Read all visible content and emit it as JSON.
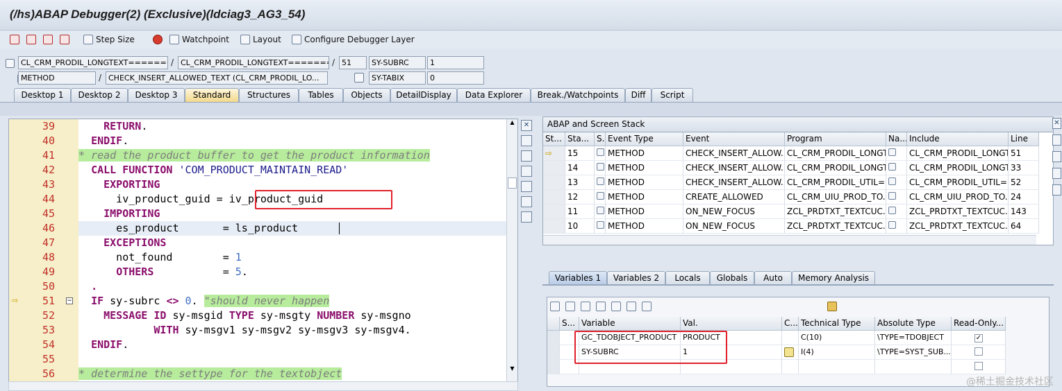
{
  "window": {
    "title": "(/hs)ABAP Debugger(2)  (Exclusive)(ldciag3_AG3_54)"
  },
  "toolbar": {
    "step_size": "Step Size",
    "watchpoint": "Watchpoint",
    "layout": "Layout",
    "configure": "Configure Debugger Layer"
  },
  "fields": {
    "row1": {
      "f1": "CL_CRM_PRODIL_LONGTEXT=======",
      "sep1": "/",
      "f2": "CL_CRM_PRODIL_LONGTEXT=======",
      "sep2": "/",
      "line": "51",
      "sysname": "SY-SUBRC",
      "sysval": "1"
    },
    "row2": {
      "type": "METHOD",
      "sep": "/",
      "name": "CHECK_INSERT_ALLOWED_TEXT (CL_CRM_PRODIL_LO...",
      "sysname": "SY-TABIX",
      "sysval": "0"
    }
  },
  "tabs": [
    "Desktop 1",
    "Desktop 2",
    "Desktop 3",
    "Standard",
    "Structures",
    "Tables",
    "Objects",
    "DetailDisplay",
    "Data Explorer",
    "Break./Watchpoints",
    "Diff",
    "Script"
  ],
  "active_tab": "Standard",
  "code": {
    "lines": [
      {
        "n": "39",
        "t": "    RETURN."
      },
      {
        "n": "40",
        "t": "  ENDIF."
      },
      {
        "n": "41",
        "t": "* read the product buffer to get the product information"
      },
      {
        "n": "42",
        "t": "  CALL FUNCTION 'COM_PRODUCT_MAINTAIN_READ'"
      },
      {
        "n": "43",
        "t": "    EXPORTING"
      },
      {
        "n": "44",
        "t": "      iv_product_guid = iv_product_guid"
      },
      {
        "n": "45",
        "t": "    IMPORTING"
      },
      {
        "n": "46",
        "t": "      es_product       = ls_product"
      },
      {
        "n": "47",
        "t": "    EXCEPTIONS"
      },
      {
        "n": "48",
        "t": "      not_found        = 1"
      },
      {
        "n": "49",
        "t": "      OTHERS           = 5."
      },
      {
        "n": "50",
        "t": "  ."
      },
      {
        "n": "51",
        "t": "  IF sy-subrc <> 0. \"should never happen"
      },
      {
        "n": "52",
        "t": "    MESSAGE ID sy-msgid TYPE sy-msgty NUMBER sy-msgno"
      },
      {
        "n": "53",
        "t": "            WITH sy-msgv1 sy-msgv2 sy-msgv3 sy-msgv4."
      },
      {
        "n": "54",
        "t": "  ENDIF."
      },
      {
        "n": "55",
        "t": ""
      },
      {
        "n": "56",
        "t": "* determine the settype for the textobject"
      }
    ]
  },
  "stack": {
    "title": "ABAP and Screen Stack",
    "headers": [
      "St...",
      "Sta...",
      "S...",
      "Event Type",
      "Event",
      "Program",
      "Na...",
      "Include",
      "Line"
    ],
    "rows": [
      {
        "sta": "15",
        "etype": "METHOD",
        "event": "CHECK_INSERT_ALLOW...",
        "program": "CL_CRM_PRODIL_LONGT...",
        "include": "CL_CRM_PRODIL_LONGT...",
        "line": "51"
      },
      {
        "sta": "14",
        "etype": "METHOD",
        "event": "CHECK_INSERT_ALLOW...",
        "program": "CL_CRM_PRODIL_LONGT...",
        "include": "CL_CRM_PRODIL_LONGT...",
        "line": "33"
      },
      {
        "sta": "13",
        "etype": "METHOD",
        "event": "CHECK_INSERT_ALLOW...",
        "program": "CL_CRM_PRODIL_UTIL=...",
        "include": "CL_CRM_PRODIL_UTIL=...",
        "line": "52"
      },
      {
        "sta": "12",
        "etype": "METHOD",
        "event": "CREATE_ALLOWED",
        "program": "CL_CRM_UIU_PROD_TO...",
        "include": "CL_CRM_UIU_PROD_TO...",
        "line": "24"
      },
      {
        "sta": "11",
        "etype": "METHOD",
        "event": "ON_NEW_FOCUS",
        "program": "ZCL_PRDTXT_TEXTCUC...",
        "include": "ZCL_PRDTXT_TEXTCUC...",
        "line": "143"
      },
      {
        "sta": "10",
        "etype": "METHOD",
        "event": "ON_NEW_FOCUS",
        "program": "ZCL_PRDTXT_TEXTCUC...",
        "include": "ZCL_PRDTXT_TEXTCUC...",
        "line": "64"
      }
    ]
  },
  "var_tabs": [
    "Variables 1",
    "Variables 2",
    "Locals",
    "Globals",
    "Auto",
    "Memory Analysis"
  ],
  "active_var_tab": "Variables 1",
  "vars": {
    "headers": [
      "S...",
      "Variable",
      "Val.",
      "C...",
      "Technical Type",
      "Absolute Type",
      "Read-Only..."
    ],
    "rows": [
      {
        "variable": "GC_TDOBJECT_PRODUCT",
        "val": "PRODUCT",
        "tech": "C(10)",
        "abs": "\\TYPE=TDOBJECT",
        "readonly": true
      },
      {
        "variable": "SY-SUBRC",
        "val": "1",
        "tech": "I(4)",
        "abs": "\\TYPE=SYST_SUB...",
        "readonly": false
      }
    ]
  },
  "watermark": "@稀土掘金技术社区"
}
